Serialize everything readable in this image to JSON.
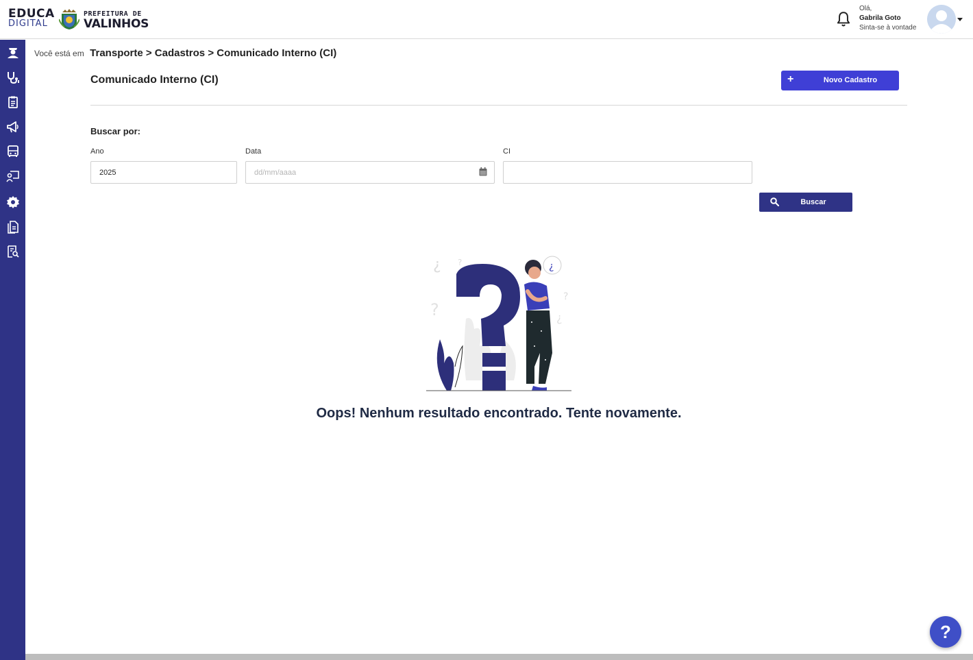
{
  "header": {
    "logo_line1": "EDUCA",
    "logo_line2": "DIGITAL",
    "pref_line1": "PREFEITURA DE",
    "pref_line2": "VALINHOS",
    "greeting": "Olá,",
    "user_name": "Gabrila Goto",
    "tagline": "Sinta-se à vontade"
  },
  "sidebar": {
    "items": [
      {
        "icon": "graduate-icon"
      },
      {
        "icon": "stethoscope-icon"
      },
      {
        "icon": "clipboard-icon"
      },
      {
        "icon": "megaphone-icon"
      },
      {
        "icon": "bus-icon"
      },
      {
        "icon": "presentation-icon"
      },
      {
        "icon": "gear-icon"
      },
      {
        "icon": "documents-icon"
      },
      {
        "icon": "report-search-icon"
      }
    ]
  },
  "breadcrumb": {
    "prefix": "Você está em",
    "path": "Transporte > Cadastros > Comunicado Interno (CI)"
  },
  "page": {
    "title": "Comunicado Interno (CI)",
    "new_button": "Novo Cadastro",
    "search_by": "Buscar por:"
  },
  "filters": {
    "ano_label": "Ano",
    "ano_value": "2025",
    "data_label": "Data",
    "data_placeholder": "dd/mm/aaaa",
    "ci_label": "CI",
    "ci_value": ""
  },
  "search_button": "Buscar",
  "empty_state": {
    "message": "Oops! Nenhum resultado encontrado. Tente novamente."
  },
  "help": {
    "label": "?"
  },
  "colors": {
    "sidebar": "#2f3386",
    "primary_button": "#3f3fd6",
    "search_button": "#2f3386",
    "help_button": "#3f4fc7"
  }
}
